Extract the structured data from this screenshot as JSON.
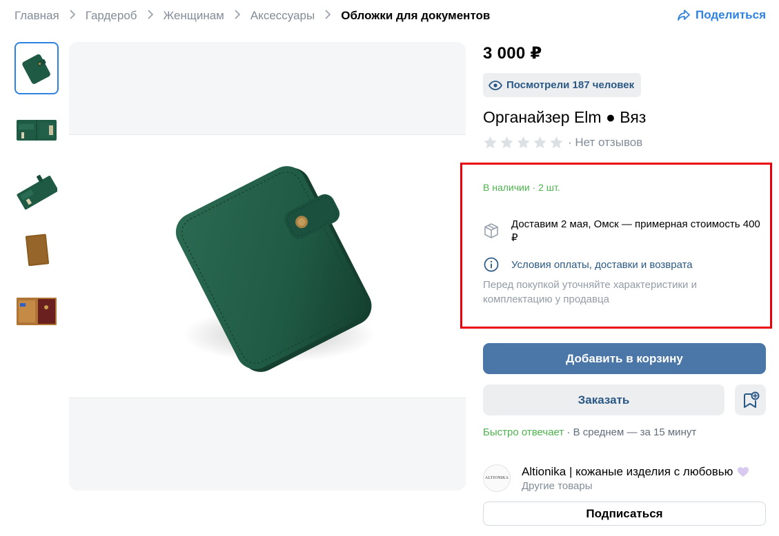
{
  "breadcrumb": {
    "items": [
      "Главная",
      "Гардероб",
      "Женщинам",
      "Аксессуары"
    ],
    "current": "Обложки для документов"
  },
  "share_label": "Поделиться",
  "gallery": {
    "thumbnails": [
      "green-cover-closed",
      "green-cover-open",
      "green-cover-open-side",
      "brown-cover",
      "passport-cover-open"
    ],
    "active_index": 0
  },
  "product": {
    "price": "3 000 ₽",
    "views": "Посмотрели 187 человек",
    "title": "Органайзер Elm ● Вяз",
    "rating_stars": 0,
    "reviews": "· Нет отзывов"
  },
  "availability": {
    "stock": "В наличии · 2 шт.",
    "delivery": "Доставим 2 мая, Омск — примерная стоимость 400 ₽",
    "terms_link": "Условия оплаты, доставки и возврата",
    "note": "Перед покупкой уточняйте характеристики и комплектацию у продавца"
  },
  "actions": {
    "add_to_cart": "Добавить в корзину",
    "order": "Заказать"
  },
  "response": {
    "fast": "Быстро отвечает",
    "avg": " · В среднем — за 15 минут"
  },
  "seller": {
    "avatar_text": "ALTIONIKA",
    "name": "Altionika | кожаные изделия с любовью",
    "other_goods": "Другие товары",
    "subscribe": "Подписаться"
  },
  "colors": {
    "accent": "#4a76a8",
    "link": "#2a5885",
    "success": "#4bb34b",
    "highlight_box": "#e8000d",
    "product_leather": "#1f5a45"
  }
}
